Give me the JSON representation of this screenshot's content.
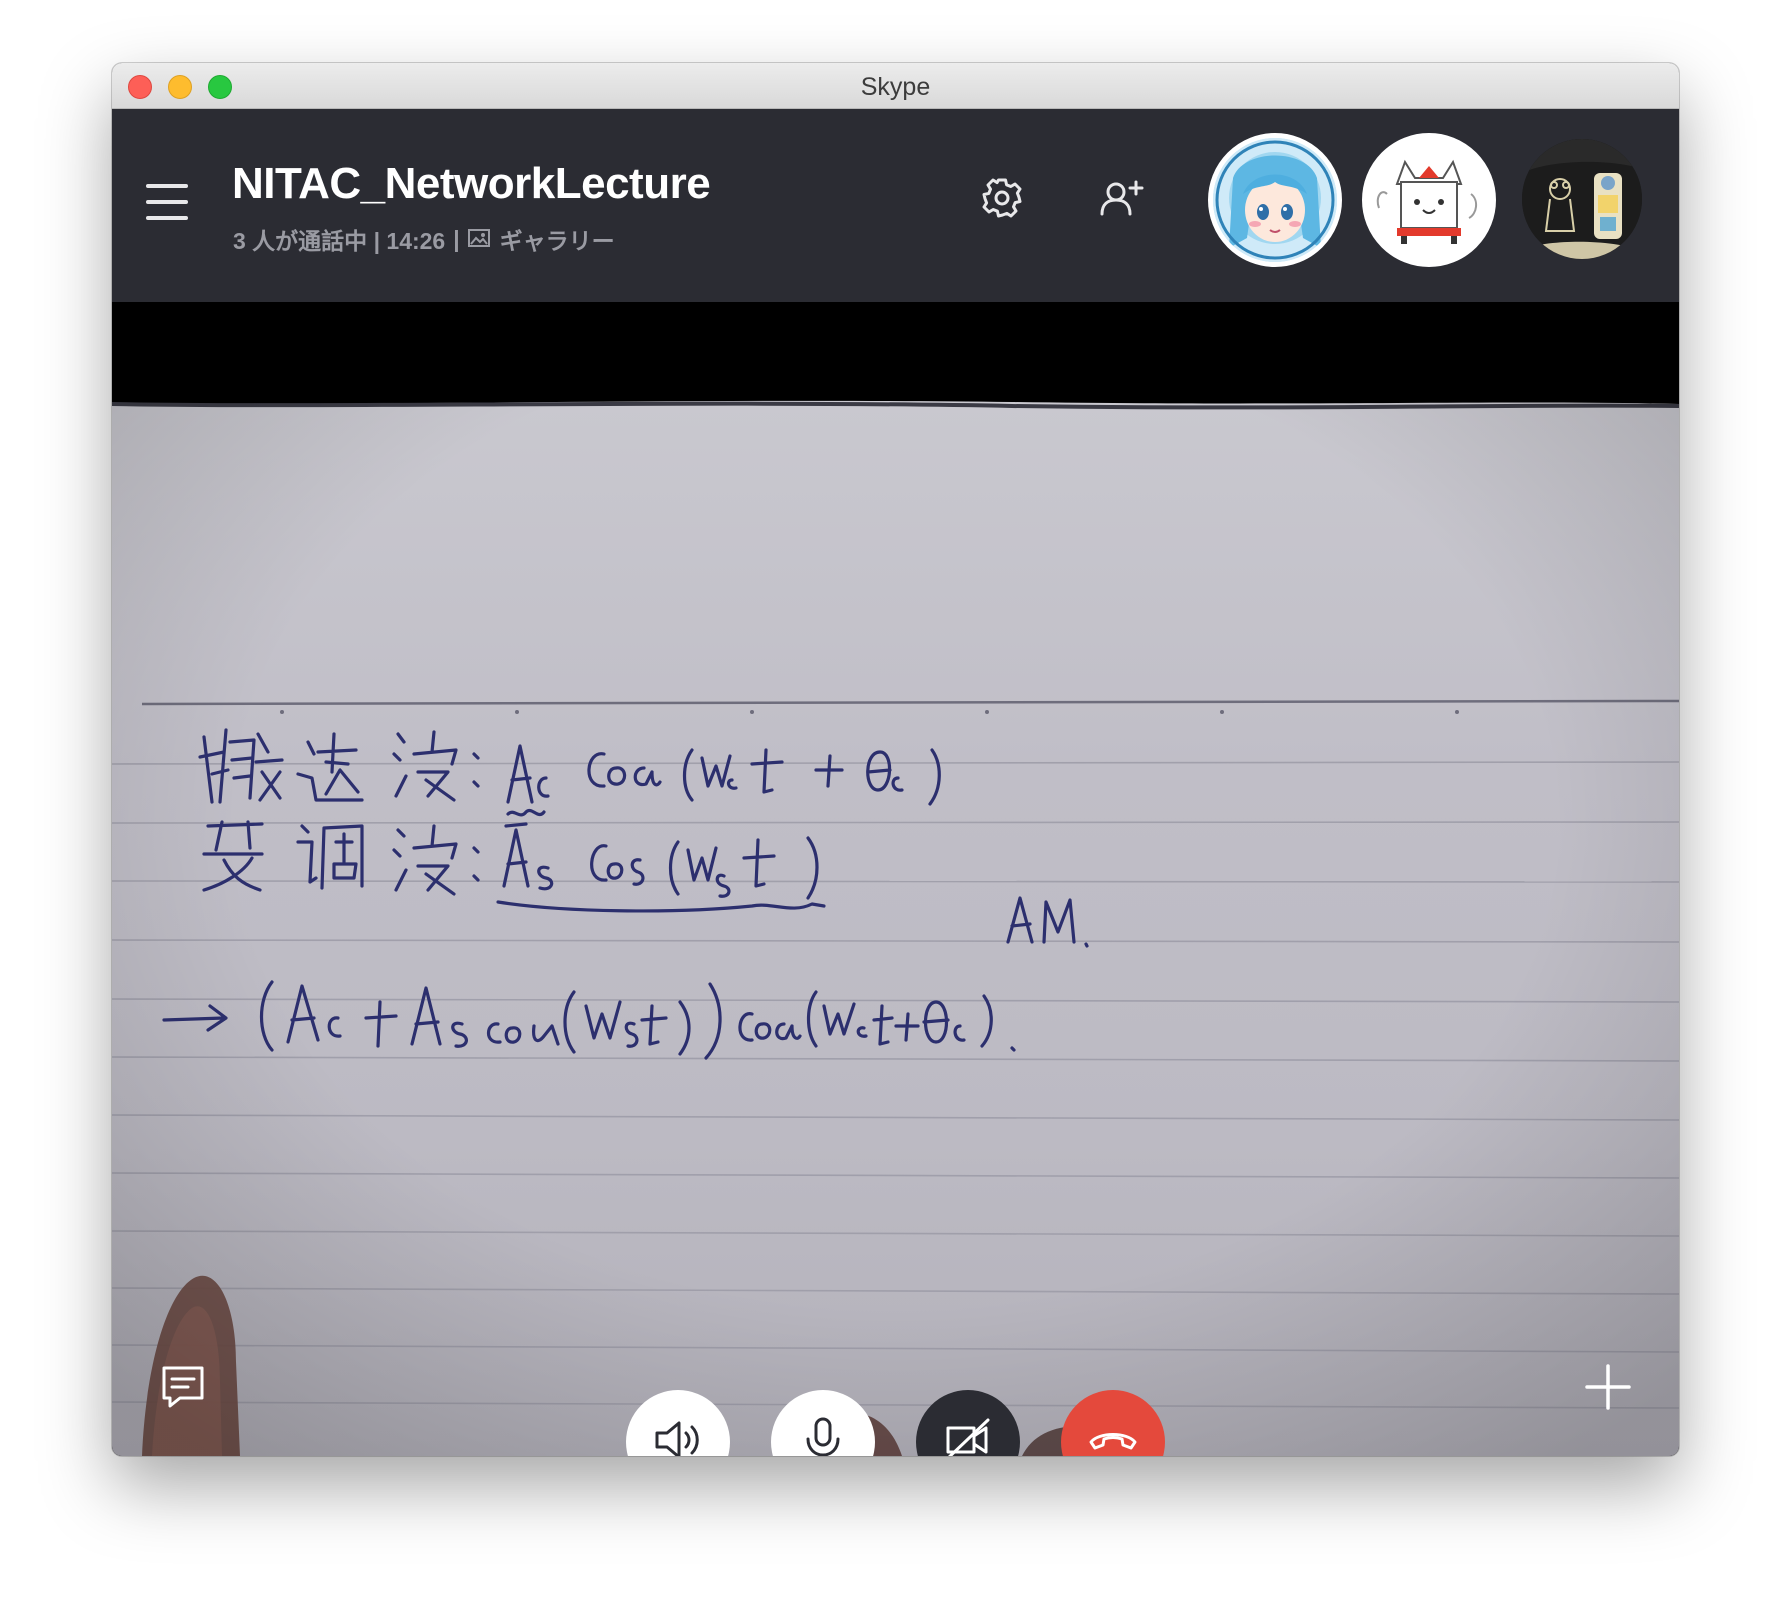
{
  "window": {
    "title": "Skype"
  },
  "call": {
    "title": "NITAC_NetworkLecture",
    "status": "3 人が通話中 | 14:26",
    "separator": "|",
    "gallery_label": "ギャラリー"
  },
  "header": {
    "menu_icon": "hamburger-menu-icon",
    "settings_icon": "gear-icon",
    "add_participant_icon": "add-person-icon"
  },
  "participants": [
    {
      "name": "participant-1",
      "ring": "#ffffff",
      "bg": "#b8dff2"
    },
    {
      "name": "participant-2",
      "ring": "#ffffff",
      "bg": "#ffffff"
    },
    {
      "name": "participant-3",
      "ring": "#2b2c33",
      "bg": "#1a1a1a"
    }
  ],
  "video_feed": {
    "content": "handwritten-notes-camera-feed"
  },
  "controls": {
    "chat_icon": "chat-icon",
    "speaker_icon": "speaker-icon",
    "mic_icon": "microphone-icon",
    "video_off_icon": "video-off-icon",
    "hangup_icon": "hang-up-icon",
    "add_icon": "plus-icon",
    "hangup_color": "#e4493c"
  }
}
